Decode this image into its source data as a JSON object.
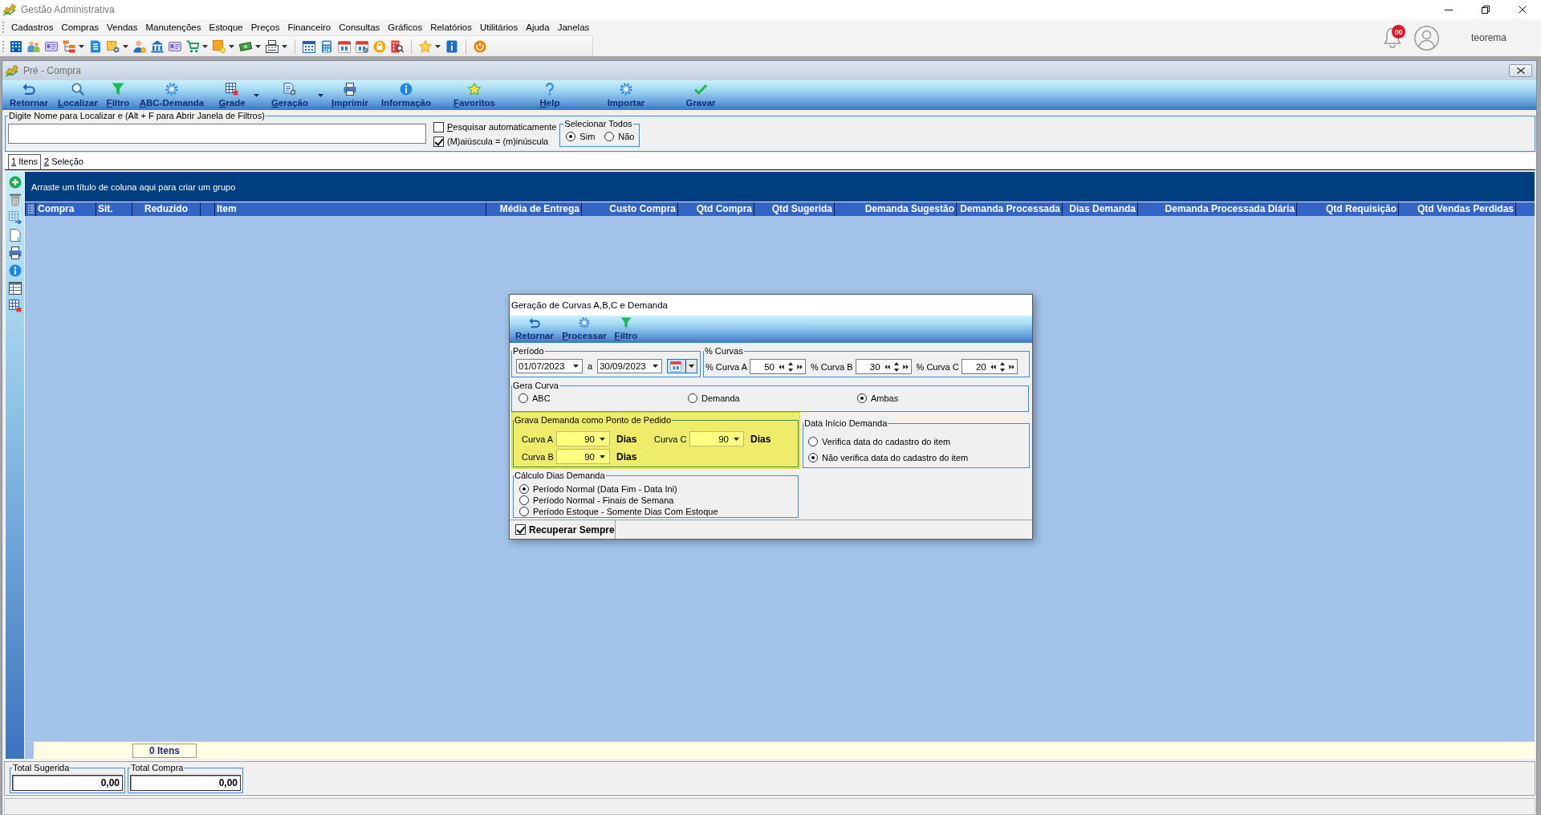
{
  "app": {
    "title": "Gestão Administrativa",
    "notifications": "00",
    "user": "teorema"
  },
  "menu": [
    "Cadastros",
    "Compras",
    "Vendas",
    "Manutenções",
    "Estoque",
    "Preços",
    "Financeiro",
    "Consultas",
    "Gráficos",
    "Relatórios",
    "Utilitários",
    "Ajuda",
    "Janelas"
  ],
  "window": {
    "title": "Pré - Compra"
  },
  "toolbar": [
    {
      "label": "Retornar",
      "hotkey": false,
      "dropdown": false
    },
    {
      "label": "Localizar",
      "hotkey": true,
      "dropdown": false
    },
    {
      "label": "Filtro",
      "hotkey": true,
      "dropdown": false
    },
    {
      "label": "ABC-Demanda",
      "hotkey": true,
      "dropdown": false
    },
    {
      "label": "Grade",
      "hotkey": true,
      "dropdown": true
    },
    {
      "label": "Geração",
      "hotkey": true,
      "dropdown": true
    },
    {
      "label": "Imprimir",
      "hotkey": true,
      "dropdown": false
    },
    {
      "label": "Informação",
      "hotkey": false,
      "dropdown": false
    },
    {
      "label": "Favoritos",
      "hotkey": true,
      "dropdown": false
    },
    {
      "label": "Help",
      "hotkey": true,
      "dropdown": false
    },
    {
      "label": "Importar",
      "hotkey": false,
      "dropdown": false
    },
    {
      "label": "Gravar",
      "hotkey": false,
      "dropdown": false
    }
  ],
  "search": {
    "label": "Digite Nome para Localizar e (Alt + F para Abrir Janela de Filtros)"
  },
  "search_options": [
    {
      "label": "Pesquisar automaticamente",
      "hotkey": true,
      "checked": false
    },
    {
      "label": "(M)aiúscula = (m)inúscula",
      "hotkey": false,
      "checked": true
    }
  ],
  "select_all": {
    "label": "Selecionar Todos",
    "options": [
      {
        "label": "Sim",
        "selected": true
      },
      {
        "label": "Não",
        "selected": false
      }
    ]
  },
  "tabs": [
    {
      "label": "1 Itens",
      "hotkey": true,
      "selected": true
    },
    {
      "label": "2 Seleção",
      "hotkey": true,
      "selected": false
    }
  ],
  "grid": {
    "group_hint": "Arraste um título de coluna aqui para criar um grupo",
    "columns": [
      {
        "label": "Compra",
        "kind": "text"
      },
      {
        "label": "Sit.",
        "kind": "text"
      },
      {
        "label": "Reduzido",
        "kind": "code"
      },
      {
        "kind": "text"
      },
      {
        "label": "Item",
        "kind": "text"
      },
      {
        "label": "Média de Entrega",
        "kind": "number"
      },
      {
        "label": "Custo Compra",
        "kind": "number"
      },
      {
        "label": "Qtd Compra",
        "kind": "number"
      },
      {
        "label": "Qtd Sugerida",
        "kind": "number"
      },
      {
        "label": "Demanda Sugestão",
        "kind": "number"
      },
      {
        "label": "Demanda Processada",
        "kind": "number"
      },
      {
        "label": "Dias Demanda",
        "kind": "number"
      },
      {
        "label": "Demanda Processada Diária",
        "kind": "number"
      },
      {
        "label": "Qtd Requisição",
        "kind": "number"
      },
      {
        "label": "Qtd Vendas Perdidas",
        "kind": "number"
      }
    ],
    "footer": "0 Itens"
  },
  "totals": [
    {
      "label": "Total Sugerida",
      "value": "0,00"
    },
    {
      "label": "Total Compra",
      "value": "0,00"
    }
  ],
  "dialog": {
    "title": "Geração de Curvas A,B,C e Demanda",
    "toolbar": [
      {
        "label": "Retornar",
        "hotkey": false
      },
      {
        "label": "Processar",
        "hotkey": true
      },
      {
        "label": "Filtro",
        "hotkey": true
      }
    ],
    "period": {
      "label": "Período",
      "start": "01/07/2023",
      "separator": "a",
      "end": "30/09/2023"
    },
    "curves": {
      "label": "% Curvas",
      "fields": [
        {
          "label": "% Curva A",
          "value": "50"
        },
        {
          "label": "% Curva B",
          "value": "30"
        },
        {
          "label": "% Curva C",
          "value": "20"
        }
      ]
    },
    "generate_curve": {
      "label": "Gera Curva",
      "options": [
        {
          "label": "ABC",
          "selected": false
        },
        {
          "label": "Demanda",
          "selected": false
        },
        {
          "label": "Ambas",
          "selected": true
        }
      ]
    },
    "reorder_point": {
      "label": "Grava Demanda como Ponto de Pedido",
      "highlighted": true,
      "fields": [
        {
          "label": "Curva A",
          "value": "90",
          "unit": "Dias"
        },
        {
          "label": "Curva C",
          "value": "90",
          "unit": "Dias"
        },
        {
          "label": "Curva B",
          "value": "90",
          "unit": "Dias"
        }
      ]
    },
    "demand_start": {
      "label": "Data Início Demanda",
      "options": [
        {
          "label": "Verifica data do cadastro do item",
          "selected": false
        },
        {
          "label": "Não verifica data do cadastro do item",
          "selected": true
        }
      ]
    },
    "days_calculation": {
      "label": "Cálculo Dias Demanda",
      "options": [
        {
          "label": "Período Normal (Data Fim - Data Ini)",
          "selected": true
        },
        {
          "label": "Período Normal - Finais de Semana",
          "selected": false
        },
        {
          "label": "Período Estoque - Somente Dias Com Estoque",
          "selected": false
        }
      ]
    },
    "recover_always": {
      "label": "Recuperar Sempre",
      "checked": true
    }
  }
}
